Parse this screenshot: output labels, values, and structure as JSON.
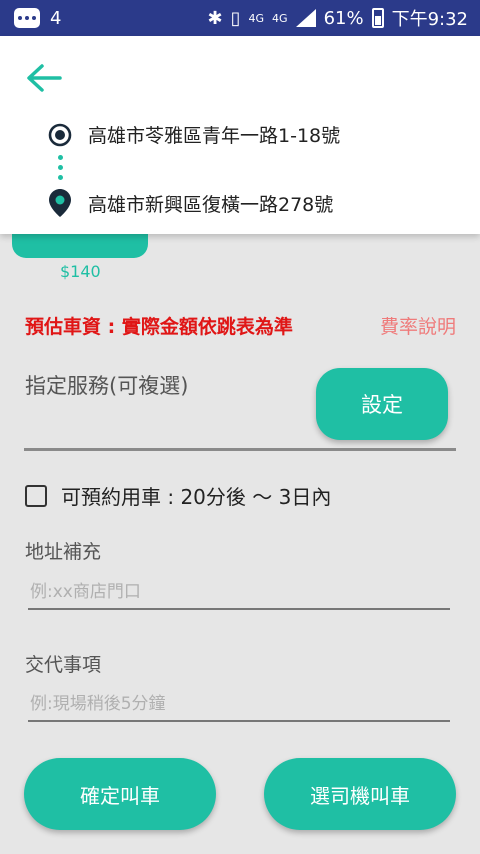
{
  "status_bar": {
    "notification_count": "4",
    "network_1": "4G",
    "network_2": "4G",
    "battery": "61%",
    "time": "下午9:32"
  },
  "route": {
    "origin": "高雄市苓雅區青年一路1-18號",
    "destination": "高雄市新興區復橫一路278號"
  },
  "fare": {
    "price": "$140",
    "estimate_label": "預估車資 : 實際金額依跳表為準",
    "rate_link": "費率說明"
  },
  "service": {
    "label": "指定服務(可複選)",
    "set_button": "設定"
  },
  "reservation": {
    "label": "可預約用車 : 20分後 〜 3日內"
  },
  "address_extra": {
    "label": "地址補充",
    "placeholder": "例:xx商店門口",
    "value": ""
  },
  "instructions": {
    "label": "交代事項",
    "placeholder": "例:現場稍後5分鐘",
    "value": ""
  },
  "actions": {
    "confirm": "確定叫車",
    "choose_driver": "選司機叫車"
  },
  "colors": {
    "accent": "#1fbfa4",
    "status_bar": "#2b3a8a",
    "fare_red": "#e01616"
  }
}
